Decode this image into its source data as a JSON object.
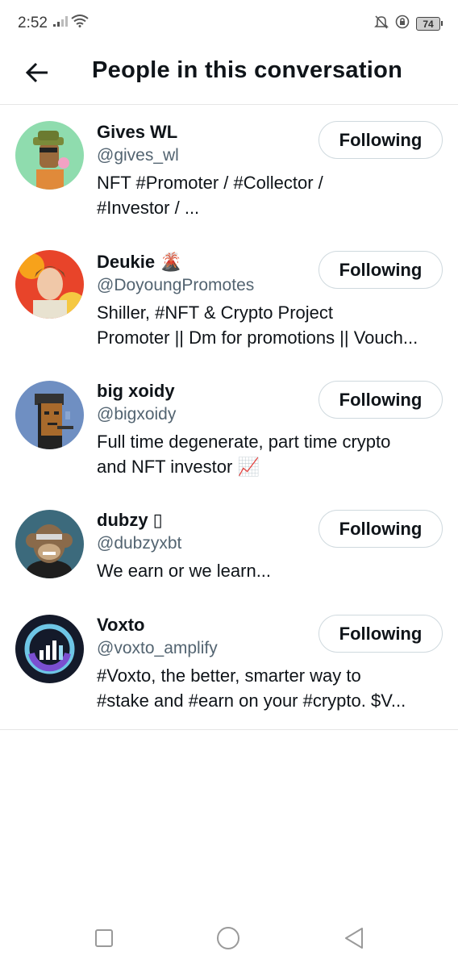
{
  "status_bar": {
    "time": "2:52",
    "battery": "74",
    "icons": [
      "signal-icon",
      "wifi-icon",
      "mute-bell-icon",
      "data-saver-icon",
      "battery-icon"
    ]
  },
  "header": {
    "back_icon": "arrow-left-icon",
    "title": "People in this conversation"
  },
  "people": [
    {
      "name": "Gives WL",
      "handle": "@gives_wl",
      "bio_line1": "NFT #Promoter / #Collector /",
      "bio_line2": "#Investor / ...",
      "button": "Following"
    },
    {
      "name": "Deukie 🌋",
      "handle": "@DoyoungPromotes",
      "bio_line1": "Shiller, #NFT & Crypto Project",
      "bio_line2": "Promoter || Dm for promotions || Vouch...",
      "button": "Following"
    },
    {
      "name": "big xoidy",
      "handle": "@bigxoidy",
      "bio_line1": "Full time degenerate, part time crypto",
      "bio_line2": "and NFT investor 📈",
      "button": "Following"
    },
    {
      "name": "dubzy ▯",
      "handle": "@dubzyxbt",
      "bio_line1": "We earn or we learn...",
      "bio_line2": "",
      "button": "Following"
    },
    {
      "name": "Voxto",
      "handle": "@voxto_amplify",
      "bio_line1": "#Voxto, the better, smarter way to",
      "bio_line2": "#stake and #earn on your #crypto. $V...",
      "button": "Following"
    }
  ],
  "nav_bar": {
    "icons": [
      "recents-square-icon",
      "home-circle-icon",
      "back-triangle-icon"
    ]
  }
}
